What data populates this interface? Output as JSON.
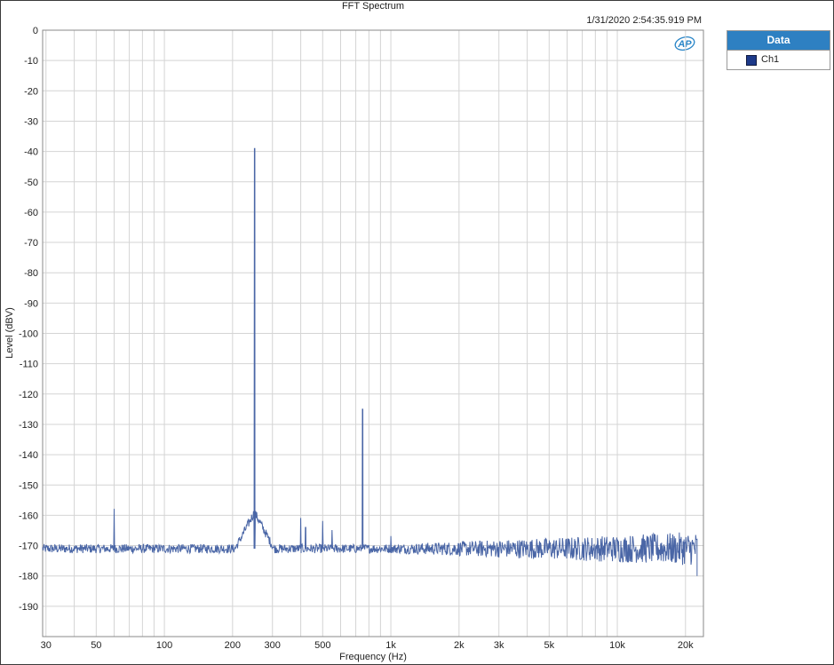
{
  "window": {
    "title": "FFT Spectrum",
    "timestamp": "1/31/2020 2:54:35.919 PM",
    "logo_text": "AP"
  },
  "legend": {
    "header": "Data",
    "series_label": "Ch1",
    "swatch_color": "#1d3a8a"
  },
  "colors": {
    "trace": "#4a66a6",
    "grid": "#d4d4d4",
    "plot_border": "#8a8a8a",
    "logo": "#2a86c8"
  },
  "chart_data": {
    "type": "line",
    "title": "FFT Spectrum",
    "xlabel": "Frequency (Hz)",
    "ylabel": "Level (dBV)",
    "x_scale": "log",
    "xlim": [
      29,
      24000
    ],
    "ylim": [
      -200,
      0
    ],
    "grid": true,
    "legend_position": "right",
    "x_ticks": [
      {
        "v": 30,
        "label": "30"
      },
      {
        "v": 50,
        "label": "50"
      },
      {
        "v": 100,
        "label": "100"
      },
      {
        "v": 200,
        "label": "200"
      },
      {
        "v": 300,
        "label": "300"
      },
      {
        "v": 500,
        "label": "500"
      },
      {
        "v": 1000,
        "label": "1k"
      },
      {
        "v": 2000,
        "label": "2k"
      },
      {
        "v": 3000,
        "label": "3k"
      },
      {
        "v": 5000,
        "label": "5k"
      },
      {
        "v": 10000,
        "label": "10k"
      },
      {
        "v": 20000,
        "label": "20k"
      }
    ],
    "y_ticks": [
      0,
      -10,
      -20,
      -30,
      -40,
      -50,
      -60,
      -70,
      -80,
      -90,
      -100,
      -110,
      -120,
      -130,
      -140,
      -150,
      -160,
      -170,
      -180,
      -190
    ],
    "series": [
      {
        "name": "Ch1",
        "color": "#4a66a6",
        "noise_floor_db": -171,
        "x_start": 29,
        "x_end": 22500,
        "peaks": [
          {
            "x": 60,
            "y": -158
          },
          {
            "x": 250,
            "y": -39
          },
          {
            "x": 400,
            "y": -161
          },
          {
            "x": 420,
            "y": -164
          },
          {
            "x": 500,
            "y": -162
          },
          {
            "x": 550,
            "y": -165
          },
          {
            "x": 750,
            "y": -125
          },
          {
            "x": 1000,
            "y": -167
          }
        ]
      }
    ]
  }
}
